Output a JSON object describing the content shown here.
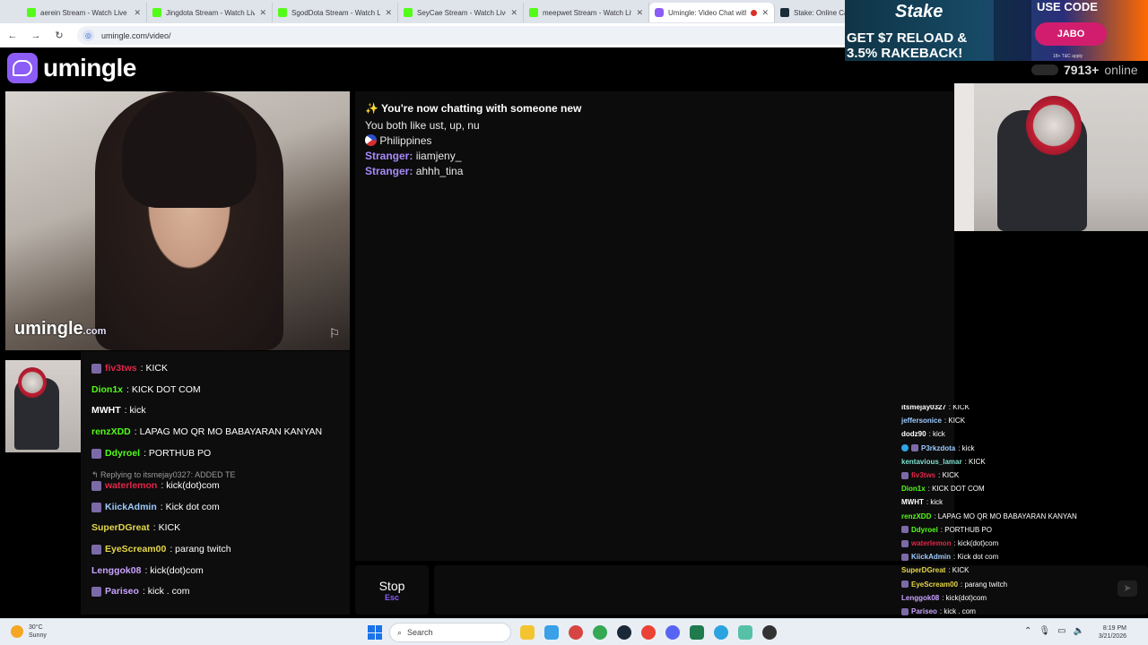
{
  "browser": {
    "tabs": [
      {
        "title": "aerein Stream - Watch Live o",
        "icon": "kick-icon",
        "active": false
      },
      {
        "title": "Jingdota Stream - Watch Live",
        "icon": "kick-icon",
        "active": false
      },
      {
        "title": "SgodDota Stream - Watch Li",
        "icon": "kick-icon",
        "active": false
      },
      {
        "title": "SeyCae Stream - Watch Live",
        "icon": "kick-icon",
        "active": false
      },
      {
        "title": "meepwet Stream - Watch Liv",
        "icon": "kick-icon",
        "active": false
      },
      {
        "title": "Umingle: Video Chat with",
        "icon": "umingle-icon",
        "active": true,
        "recording": true
      },
      {
        "title": "Stake: Online Casi",
        "icon": "stake-icon",
        "active": false
      }
    ],
    "url": "umingle.com/video/"
  },
  "ad": {
    "logo": "Stake",
    "headline_line1": "GET $7 RELOAD &",
    "headline_line2": "3.5% RAKEBACK!",
    "use_code": "USE CODE",
    "code": "JABO",
    "fineprint": "18+ T&C apply"
  },
  "site": {
    "brand": "umingle",
    "online_count": "7913+",
    "online_label": "online",
    "watermark_main": "umingle",
    "watermark_suffix": ".com"
  },
  "chat": {
    "intro": "✨ You're now chatting with someone new",
    "interests": "You both like ust, up, nu",
    "country": "Philippines",
    "messages": [
      {
        "sender": "Stranger:",
        "text": "iiamjeny_"
      },
      {
        "sender": "Stranger:",
        "text": "ahhh_tina"
      }
    ],
    "stop_label": "Stop",
    "stop_key": "Esc",
    "input_placeholder": "",
    "send_icon": "send-icon"
  },
  "left_stream_chat": {
    "reply_text": "Replying to itsmejay0327: ADDED TE",
    "rows": [
      {
        "user": "fiv3tws",
        "text": ": KICK",
        "color": "#e0264a",
        "badge": true
      },
      {
        "user": "Dion1x",
        "text": ": KICK DOT COM",
        "color": "#53fc18",
        "badge": false
      },
      {
        "user": "MWHT",
        "text": ": kick",
        "color": "#ffffff",
        "badge": false
      },
      {
        "user": "renzXDD",
        "text": ": LAPAG MO QR MO BABAYARAN KANYAN",
        "color": "#53fc18",
        "badge": false
      },
      {
        "user": "Ddyroel",
        "text": ": PORTHUB PO",
        "color": "#53fc18",
        "badge": true
      },
      {
        "user": "waterlemon",
        "text": ": kick(dot)com",
        "color": "#e0264a",
        "badge": true
      },
      {
        "user": "KiickAdmin",
        "text": ": Kick dot com",
        "color": "#9ecbff",
        "badge": true
      },
      {
        "user": "SuperDGreat",
        "text": ": KICK",
        "color": "#e6d74a",
        "badge": false
      },
      {
        "user": "EyeScream00",
        "text": ": parang twitch",
        "color": "#e6d74a",
        "badge": true
      },
      {
        "user": "Lenggok08",
        "text": ": kick(dot)com",
        "color": "#c9a3ff",
        "badge": false
      },
      {
        "user": "Pariseo",
        "text": ": kick . com",
        "color": "#c9a3ff",
        "badge": true
      }
    ]
  },
  "right_stream_chat": {
    "rows": [
      {
        "user": "itsmejay0327",
        "text": ": KICK",
        "color": "#ffffff",
        "badge": ""
      },
      {
        "user": "jeffersonice",
        "text": ": KICK",
        "color": "#9ecbff",
        "badge": ""
      },
      {
        "user": "dodz90",
        "text": ": kick",
        "color": "#ffffff",
        "badge": ""
      },
      {
        "user": "P3rkzdota",
        "text": ": kick",
        "color": "#9ecbff",
        "badge": "both"
      },
      {
        "user": "kentavious_lamar",
        "text": ": KICK",
        "color": "#7fe0d0",
        "badge": ""
      },
      {
        "user": "fiv3tws",
        "text": ": KICK",
        "color": "#e0264a",
        "badge": "sub"
      },
      {
        "user": "Dion1x",
        "text": ": KICK DOT COM",
        "color": "#53fc18",
        "badge": ""
      },
      {
        "user": "MWHT",
        "text": ": kick",
        "color": "#ffffff",
        "badge": ""
      },
      {
        "user": "renzXDD",
        "text": ": LAPAG MO QR MO BABAYARAN KANYAN",
        "color": "#53fc18",
        "badge": ""
      },
      {
        "user": "Ddyroel",
        "text": ": PORTHUB PO",
        "color": "#53fc18",
        "badge": "sub"
      },
      {
        "user": "waterlemon",
        "text": ": kick(dot)com",
        "color": "#e0264a",
        "badge": "sub"
      },
      {
        "user": "KiickAdmin",
        "text": ": Kick dot com",
        "color": "#9ecbff",
        "badge": "sub"
      },
      {
        "user": "SuperDGreat",
        "text": ": KICK",
        "color": "#e6d74a",
        "badge": ""
      },
      {
        "user": "EyeScream00",
        "text": ": parang twitch",
        "color": "#e6d74a",
        "badge": "sub"
      },
      {
        "user": "Lenggok08",
        "text": ": kick(dot)com",
        "color": "#c9a3ff",
        "badge": ""
      },
      {
        "user": "Pariseo",
        "text": ": kick . com",
        "color": "#c9a3ff",
        "badge": "sub"
      }
    ]
  },
  "taskbar": {
    "temperature": "30°C",
    "condition": "Sunny",
    "search_placeholder": "Search",
    "time": "8:19 PM",
    "date": "3/21/2026"
  },
  "colors": {
    "accent": "#8b5cf6",
    "stranger": "#a78bfa",
    "panel": "#0c0c0c"
  }
}
